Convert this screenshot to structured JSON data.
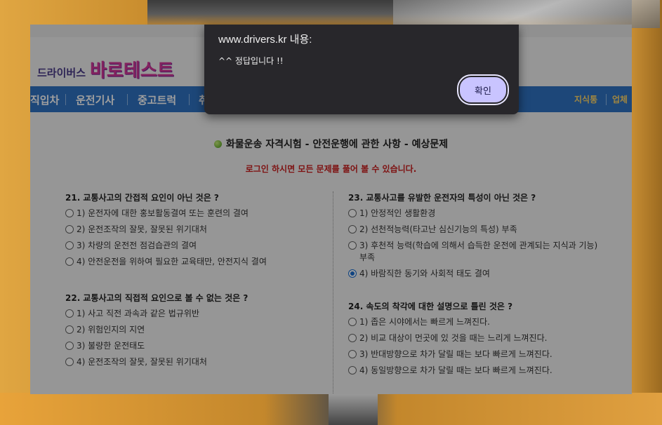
{
  "site": {
    "logo_small": "드라이버스",
    "logo_big": "바로테스트",
    "nav": [
      "직입차",
      "운전기사",
      "중고트럭",
      "취"
    ],
    "nav_right": [
      "지식통",
      "업체"
    ]
  },
  "page": {
    "headline": "화물운송 자격시험 - 안전운행에 관한 사항 - 예상문제",
    "notice": "로그인 하시면 모든 문제를 풀어 볼 수 있습니다."
  },
  "questions": [
    {
      "title": "21. 교통사고의 간접적 요인이 아닌 것은 ?",
      "options": [
        "1) 운전자에 대한 홍보활동결여 또는 훈련의 결여",
        "2) 운전조작의 잘못, 잘못된 위기대처",
        "3) 차량의 운전전 점검습관의 결여",
        "4) 안전운전을 위하여 필요한 교육태만, 안전지식 결여"
      ],
      "selected": null
    },
    {
      "title": "22. 교통사고의 직접적 요인으로 볼 수 없는 것은 ?",
      "options": [
        "1) 사고 직전 과속과 같은 법규위반",
        "2) 위험인지의 지연",
        "3) 불량한 운전태도",
        "4) 운전조작의 잘못, 잘못된 위기대처"
      ],
      "selected": null
    },
    {
      "title": "23. 교통사고를 유발한 운전자의 특성이 아닌 것은 ?",
      "options": [
        "1) 안정적인 생활환경",
        "2) 선천적능력(타고난 심신기능의 특성) 부족",
        "3) 후천적 능력(학습에 의해서 습득한 운전에 관계되는 지식과 기능) 부족",
        "4) 바람직한 동기와 사회적 태도 결여"
      ],
      "selected": 3
    },
    {
      "title": "24. 속도의 착각에 대한 설명으로 틀린 것은 ?",
      "options": [
        "1) 좁은 시야에서는 빠르게 느껴진다.",
        "2) 비교 대상이 먼곳에 있 것을 때는 느리게 느껴진다.",
        "3) 반대방향으로 차가 달릴 때는 보다 빠르게 느껴진다.",
        "4) 동일방향으로 차가 달릴 때는 보다 빠르게 느껴진다."
      ],
      "selected": null
    }
  ],
  "dialog": {
    "title": "www.drivers.kr 내용:",
    "message": "^^ 정답입니다 !!",
    "ok_label": "확인"
  },
  "colors": {
    "nav_blue": "#2f73c4",
    "notice_red": "#cc1f1f",
    "dialog_bg": "#28272b",
    "button_bg": "#c9c4ff"
  }
}
